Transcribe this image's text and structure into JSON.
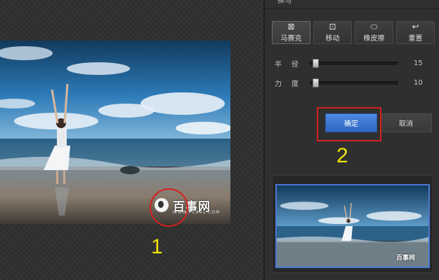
{
  "panel": {
    "title": "换马",
    "tools": [
      {
        "label": "马赛克",
        "icon": "mosaic-icon",
        "glyph": "⊠"
      },
      {
        "label": "移动",
        "icon": "move-icon",
        "glyph": "⊡"
      },
      {
        "label": "橡皮擦",
        "icon": "eraser-icon",
        "glyph": "⬭"
      },
      {
        "label": "重置",
        "icon": "reset-icon",
        "glyph": "↩"
      }
    ],
    "sliders": [
      {
        "label": "半径",
        "value": "15",
        "level": 0.0
      },
      {
        "label": "力度",
        "value": "10",
        "level": 0.0
      }
    ],
    "ok_label": "确定",
    "cancel_label": "取消"
  },
  "watermark": {
    "text": "百事网",
    "sub": "WWW.PC841.COM"
  },
  "thumb_watermark": "百事网",
  "annotations": {
    "step1": "1",
    "step2": "2",
    "color": "#d62020",
    "number_color": "#f1e20e"
  },
  "colors": {
    "accent": "#3a76d4",
    "panel": "#2f2f2f"
  }
}
